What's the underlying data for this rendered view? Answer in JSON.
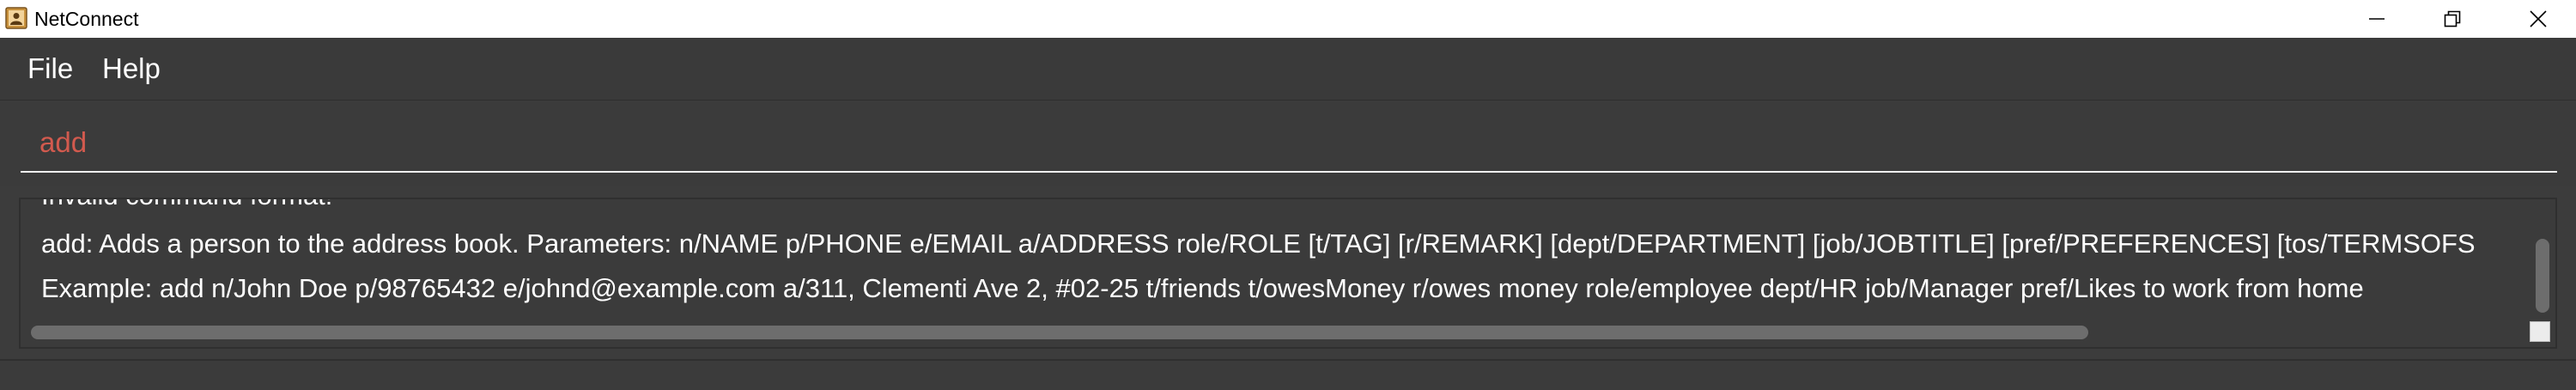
{
  "window": {
    "title": "NetConnect",
    "icon": "address-book-icon",
    "controls": [
      "minimize-icon",
      "restore-icon",
      "close-icon"
    ]
  },
  "menu": {
    "file_label": "File",
    "help_label": "Help"
  },
  "command_box": {
    "value": "add"
  },
  "result_display": {
    "lines": [
      "Invalid command format!",
      "add: Adds a person to the address book. Parameters: n/NAME p/PHONE e/EMAIL a/ADDRESS role/ROLE [t/TAG] [r/REMARK] [dept/DEPARTMENT] [job/JOBTITLE] [pref/PREFERENCES] [tos/TERMSOFS",
      "Example: add n/John Doe p/98765432 e/johnd@example.com a/311, Clementi Ave 2, #02-25 t/friends t/owesMoney r/owes money role/employee dept/HR job/Manager pref/Likes to work from home"
    ]
  },
  "colors": {
    "background": "#3b3b3b",
    "command_text": "#d25a4e",
    "text": "#ffffff"
  }
}
